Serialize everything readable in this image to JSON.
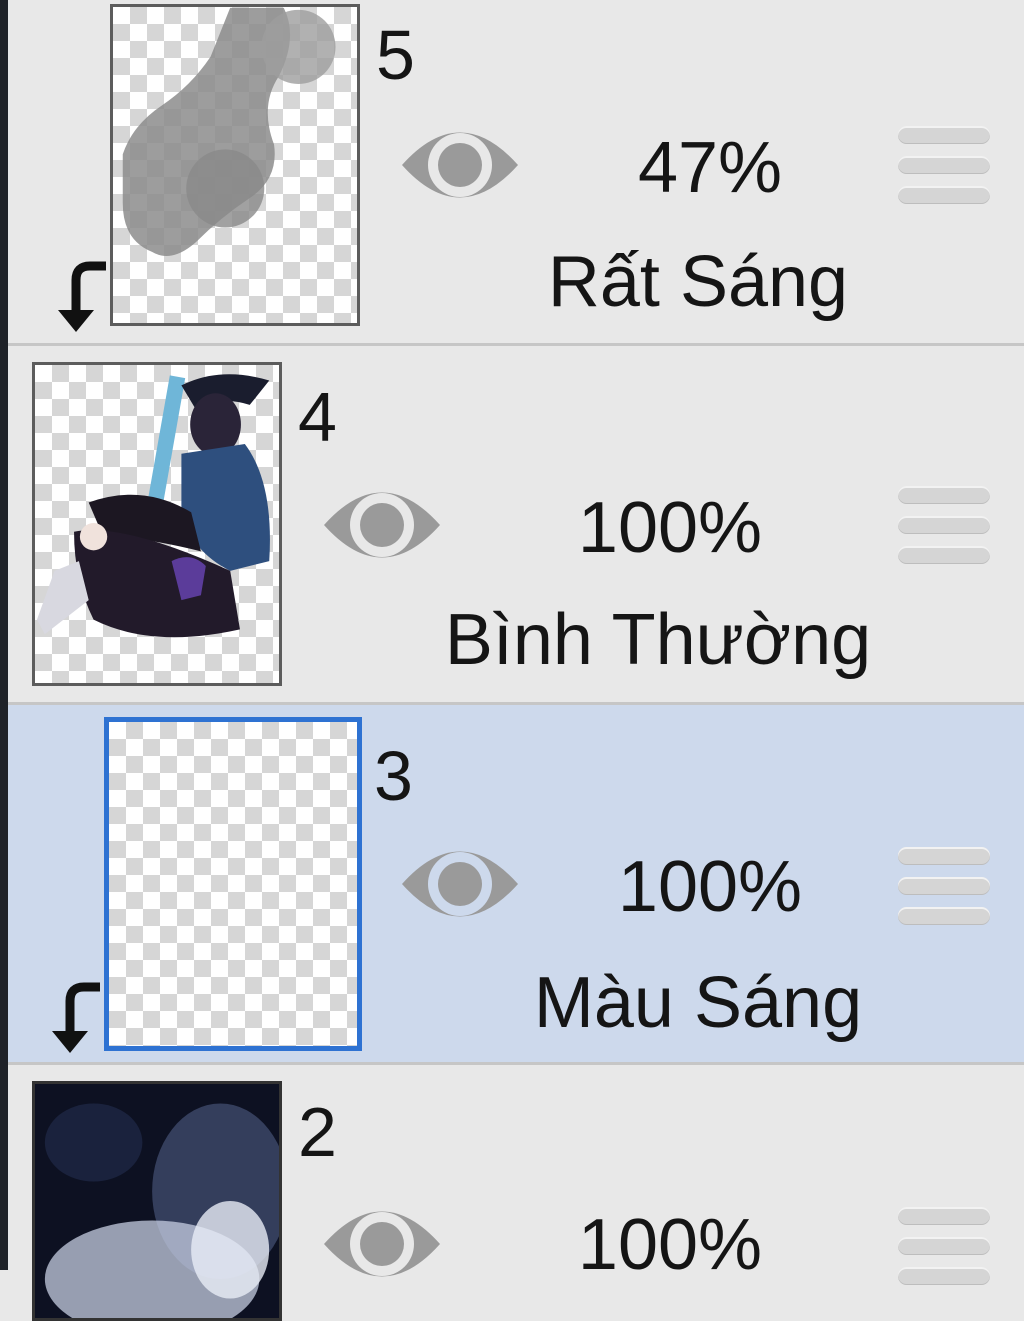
{
  "layers": [
    {
      "number": "5",
      "opacity": "47%",
      "blend_mode": "Rất Sáng",
      "visible": true,
      "clipped": true,
      "selected": false
    },
    {
      "number": "4",
      "opacity": "100%",
      "blend_mode": "Bình Thường",
      "visible": true,
      "clipped": false,
      "selected": false
    },
    {
      "number": "3",
      "opacity": "100%",
      "blend_mode": "Màu Sáng",
      "visible": true,
      "clipped": true,
      "selected": true
    },
    {
      "number": "2",
      "opacity": "100%",
      "blend_mode": "",
      "visible": true,
      "clipped": false,
      "selected": false
    }
  ],
  "icons": {
    "visibility": "eye-icon",
    "reorder": "drag-handle-icon",
    "clipping": "clipping-arrow-icon"
  },
  "colors": {
    "panel_bg": "#e8e8e8",
    "selected_bg": "#cdd9ec",
    "selected_border": "#2e72d2",
    "icon_gray": "#9a9a9a"
  }
}
